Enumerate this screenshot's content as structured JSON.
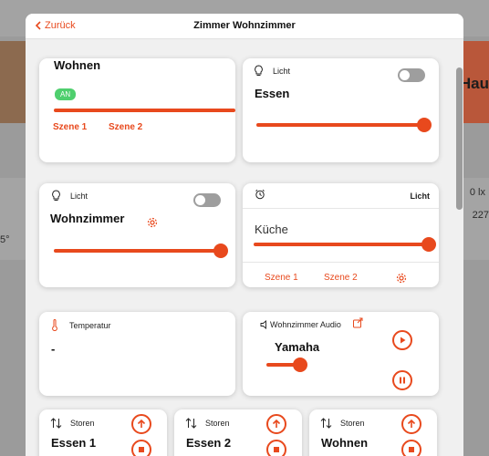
{
  "background": {
    "hau_text": "Hau",
    "lux_text": "0 lx",
    "value_227": "227",
    "value_5": "5°"
  },
  "modal": {
    "back_label": "Zurück",
    "title": "Zimmer Wohnzimmer"
  },
  "cards": {
    "wohnen": {
      "title": "Wohnen",
      "badge": "AN",
      "scenes": [
        "Szene 1",
        "Szene 2"
      ]
    },
    "essen": {
      "category": "Licht",
      "title": "Essen",
      "slider_level": 1.0
    },
    "wohnzimmer": {
      "category": "Licht",
      "title": "Wohnzimmer",
      "slider_level": 1.0
    },
    "kueche": {
      "header_label": "Licht",
      "title": "Küche",
      "slider_level": 1.0,
      "scenes": [
        "Szene 1",
        "Szene 2"
      ]
    },
    "temperatur": {
      "category": "Temperatur",
      "value": "-"
    },
    "audio": {
      "category": "Wohnzimmer Audio",
      "title": "Yamaha",
      "volume_level": 0.2
    },
    "storen": [
      {
        "category": "Storen",
        "title": "Essen 1"
      },
      {
        "category": "Storen",
        "title": "Essen 2"
      },
      {
        "category": "Storen",
        "title": "Wohnen"
      }
    ]
  },
  "colors": {
    "accent": "#e8491d",
    "on_green": "#4fcf6e",
    "toggle_off": "#9e9e9e"
  }
}
